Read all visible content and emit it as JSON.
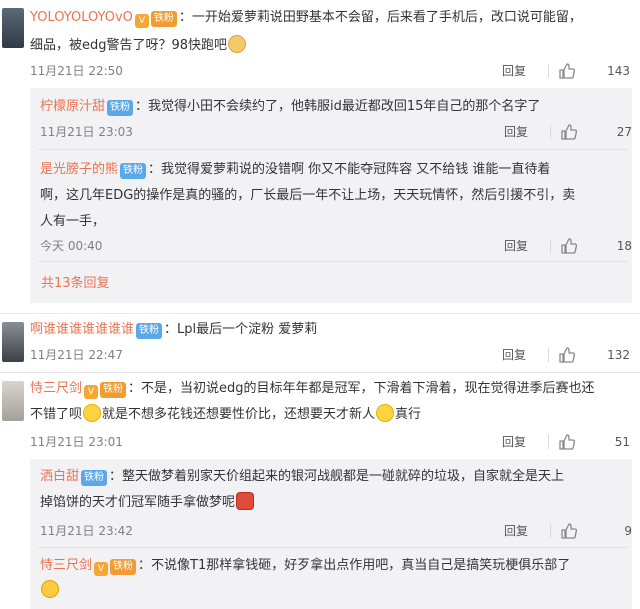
{
  "comments": [
    {
      "user": "YOLOYOLOYOvO",
      "vip_badge": "V",
      "fan_badge": "铁粉",
      "text_line1": "：一开始爱萝莉说田野基本不会留，后来看了手机后，改口说可能留，",
      "text_line2": "细品，被edg警告了呀？98快跑吧",
      "time": "11月21日 22:50",
      "reply_label": "回复",
      "likes": "143",
      "replies": [
        {
          "user": "柠檬原汁甜",
          "fan_badge": "铁粉",
          "text_line1": "：我觉得小田不会续约了，他韩服id最近都改回15年自己的那个名字了",
          "time": "11月21日 23:03",
          "reply_label": "回复",
          "likes": "27"
        },
        {
          "user": "是光膀子的熊",
          "fan_badge": "铁粉",
          "text_line1": "：我觉得爱萝莉说的没错啊 你又不能夺冠阵容 又不给钱  谁能一直待着",
          "text_line2": "啊，这几年EDG的操作是真的骚的，厂长最后一年不让上场，天天玩情怀，然后引援不引，卖",
          "text_line3": "人有一手，",
          "time": "今天 00:40",
          "reply_label": "回复",
          "likes": "18"
        }
      ],
      "more_replies": "共13条回复"
    },
    {
      "user": "啊谁谁谁谁谁谁谁",
      "fan_badge": "铁粉",
      "text_line1": "：Lpl最后一个淀粉 爱萝莉",
      "time": "11月21日 22:47",
      "reply_label": "回复",
      "likes": "132"
    },
    {
      "user": "恃三尺剑",
      "vip_badge": "V",
      "fan_badge": "铁粉",
      "text_line1": "：不是，当初说edg的目标年年都是冠军，下滑着下滑着，现在觉得进季后赛也还",
      "text_line2a": "不错了呗",
      "text_line2b": "就是不想多花钱还想要性价比，还想要天才新人",
      "text_line2c": "真行",
      "time": "11月21日 23:01",
      "reply_label": "回复",
      "likes": "51",
      "replies": [
        {
          "user": "洒白甜",
          "fan_badge": "铁粉",
          "text_line1": "：整天做梦着别家天价组起来的银河战舰都是一碰就碎的垃圾，自家就全是天上",
          "text_line2": "掉馅饼的天才们冠军随手拿做梦呢",
          "time": "11月21日 23:42",
          "reply_label": "回复",
          "likes": "9"
        },
        {
          "user": "恃三尺剑",
          "vip_badge": "V",
          "fan_badge": "铁粉",
          "text_line1": "：不说像T1那样拿钱砸，好歹拿出点作用吧，真当自己是搞笑玩梗俱乐部了"
        }
      ]
    }
  ],
  "icons": {
    "like": "thumbs-up-icon",
    "emoji_dog": "doge-emoji-icon",
    "emoji_shy": "awkward-emoji-icon",
    "emoji_pray": "pray-emoji-icon",
    "emoji_bowl": "bowl-emoji-icon",
    "emoji_smile": "smile-emoji-icon"
  },
  "colors": {
    "username": "#eb7350",
    "fan_badge": "#f29b33",
    "fan_badge_blue": "#5aa8e8",
    "reply_bg": "#f2f2f5"
  }
}
